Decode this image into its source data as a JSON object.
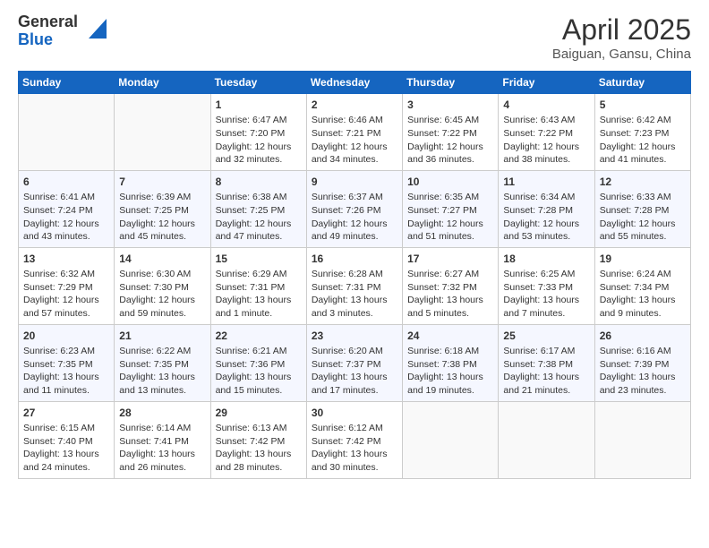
{
  "logo": {
    "general": "General",
    "blue": "Blue"
  },
  "title": "April 2025",
  "subtitle": "Baiguan, Gansu, China",
  "days_of_week": [
    "Sunday",
    "Monday",
    "Tuesday",
    "Wednesday",
    "Thursday",
    "Friday",
    "Saturday"
  ],
  "weeks": [
    [
      {
        "day": "",
        "info": ""
      },
      {
        "day": "",
        "info": ""
      },
      {
        "day": "1",
        "info": "Sunrise: 6:47 AM\nSunset: 7:20 PM\nDaylight: 12 hours\nand 32 minutes."
      },
      {
        "day": "2",
        "info": "Sunrise: 6:46 AM\nSunset: 7:21 PM\nDaylight: 12 hours\nand 34 minutes."
      },
      {
        "day": "3",
        "info": "Sunrise: 6:45 AM\nSunset: 7:22 PM\nDaylight: 12 hours\nand 36 minutes."
      },
      {
        "day": "4",
        "info": "Sunrise: 6:43 AM\nSunset: 7:22 PM\nDaylight: 12 hours\nand 38 minutes."
      },
      {
        "day": "5",
        "info": "Sunrise: 6:42 AM\nSunset: 7:23 PM\nDaylight: 12 hours\nand 41 minutes."
      }
    ],
    [
      {
        "day": "6",
        "info": "Sunrise: 6:41 AM\nSunset: 7:24 PM\nDaylight: 12 hours\nand 43 minutes."
      },
      {
        "day": "7",
        "info": "Sunrise: 6:39 AM\nSunset: 7:25 PM\nDaylight: 12 hours\nand 45 minutes."
      },
      {
        "day": "8",
        "info": "Sunrise: 6:38 AM\nSunset: 7:25 PM\nDaylight: 12 hours\nand 47 minutes."
      },
      {
        "day": "9",
        "info": "Sunrise: 6:37 AM\nSunset: 7:26 PM\nDaylight: 12 hours\nand 49 minutes."
      },
      {
        "day": "10",
        "info": "Sunrise: 6:35 AM\nSunset: 7:27 PM\nDaylight: 12 hours\nand 51 minutes."
      },
      {
        "day": "11",
        "info": "Sunrise: 6:34 AM\nSunset: 7:28 PM\nDaylight: 12 hours\nand 53 minutes."
      },
      {
        "day": "12",
        "info": "Sunrise: 6:33 AM\nSunset: 7:28 PM\nDaylight: 12 hours\nand 55 minutes."
      }
    ],
    [
      {
        "day": "13",
        "info": "Sunrise: 6:32 AM\nSunset: 7:29 PM\nDaylight: 12 hours\nand 57 minutes."
      },
      {
        "day": "14",
        "info": "Sunrise: 6:30 AM\nSunset: 7:30 PM\nDaylight: 12 hours\nand 59 minutes."
      },
      {
        "day": "15",
        "info": "Sunrise: 6:29 AM\nSunset: 7:31 PM\nDaylight: 13 hours\nand 1 minute."
      },
      {
        "day": "16",
        "info": "Sunrise: 6:28 AM\nSunset: 7:31 PM\nDaylight: 13 hours\nand 3 minutes."
      },
      {
        "day": "17",
        "info": "Sunrise: 6:27 AM\nSunset: 7:32 PM\nDaylight: 13 hours\nand 5 minutes."
      },
      {
        "day": "18",
        "info": "Sunrise: 6:25 AM\nSunset: 7:33 PM\nDaylight: 13 hours\nand 7 minutes."
      },
      {
        "day": "19",
        "info": "Sunrise: 6:24 AM\nSunset: 7:34 PM\nDaylight: 13 hours\nand 9 minutes."
      }
    ],
    [
      {
        "day": "20",
        "info": "Sunrise: 6:23 AM\nSunset: 7:35 PM\nDaylight: 13 hours\nand 11 minutes."
      },
      {
        "day": "21",
        "info": "Sunrise: 6:22 AM\nSunset: 7:35 PM\nDaylight: 13 hours\nand 13 minutes."
      },
      {
        "day": "22",
        "info": "Sunrise: 6:21 AM\nSunset: 7:36 PM\nDaylight: 13 hours\nand 15 minutes."
      },
      {
        "day": "23",
        "info": "Sunrise: 6:20 AM\nSunset: 7:37 PM\nDaylight: 13 hours\nand 17 minutes."
      },
      {
        "day": "24",
        "info": "Sunrise: 6:18 AM\nSunset: 7:38 PM\nDaylight: 13 hours\nand 19 minutes."
      },
      {
        "day": "25",
        "info": "Sunrise: 6:17 AM\nSunset: 7:38 PM\nDaylight: 13 hours\nand 21 minutes."
      },
      {
        "day": "26",
        "info": "Sunrise: 6:16 AM\nSunset: 7:39 PM\nDaylight: 13 hours\nand 23 minutes."
      }
    ],
    [
      {
        "day": "27",
        "info": "Sunrise: 6:15 AM\nSunset: 7:40 PM\nDaylight: 13 hours\nand 24 minutes."
      },
      {
        "day": "28",
        "info": "Sunrise: 6:14 AM\nSunset: 7:41 PM\nDaylight: 13 hours\nand 26 minutes."
      },
      {
        "day": "29",
        "info": "Sunrise: 6:13 AM\nSunset: 7:42 PM\nDaylight: 13 hours\nand 28 minutes."
      },
      {
        "day": "30",
        "info": "Sunrise: 6:12 AM\nSunset: 7:42 PM\nDaylight: 13 hours\nand 30 minutes."
      },
      {
        "day": "",
        "info": ""
      },
      {
        "day": "",
        "info": ""
      },
      {
        "day": "",
        "info": ""
      }
    ]
  ]
}
